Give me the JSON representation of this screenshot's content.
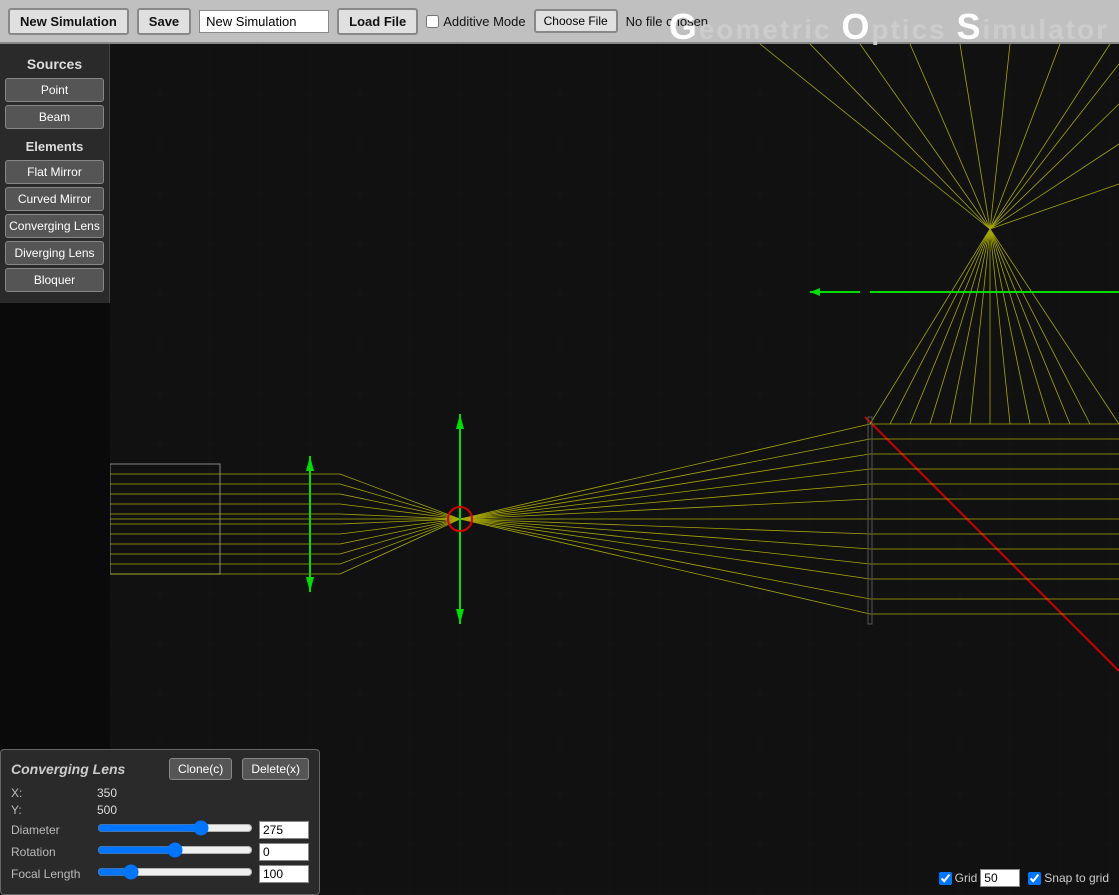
{
  "toolbar": {
    "new_simulation_label": "New Simulation",
    "save_label": "Save",
    "sim_name_value": "New Simulation",
    "load_file_label": "Load File",
    "additive_mode_label": "Additive Mode",
    "choose_file_label": "Choose File",
    "no_file_text": "No file chosen"
  },
  "title": {
    "g": "G",
    "g_rest": "eometric",
    "o": "O",
    "o_rest": "ptics",
    "s": "S",
    "s_rest": "imulator"
  },
  "sidebar": {
    "sources_label": "Sources",
    "point_label": "Point",
    "beam_label": "Beam",
    "elements_label": "Elements",
    "flat_mirror_label": "Flat Mirror",
    "curved_mirror_label": "Curved Mirror",
    "converging_lens_label": "Converging Lens",
    "diverging_lens_label": "Diverging Lens",
    "bloquer_label": "Bloquer"
  },
  "bottom_panel": {
    "title": "Converging Lens",
    "clone_label": "Clone(c)",
    "delete_label": "Delete(x)",
    "x_label": "X:",
    "x_value": "350",
    "y_label": "Y:",
    "y_value": "500",
    "diameter_label": "Diameter",
    "diameter_value": "275",
    "diameter_slider": 60,
    "rotation_label": "Rotation",
    "rotation_value": "0",
    "rotation_slider": 10,
    "focal_label": "Focal Length",
    "focal_value": "100",
    "focal_slider": 20
  },
  "bottom_controls": {
    "grid_label": "Grid",
    "grid_value": "50",
    "snap_label": "Snap to grid",
    "grid_checked": true,
    "snap_checked": true
  }
}
